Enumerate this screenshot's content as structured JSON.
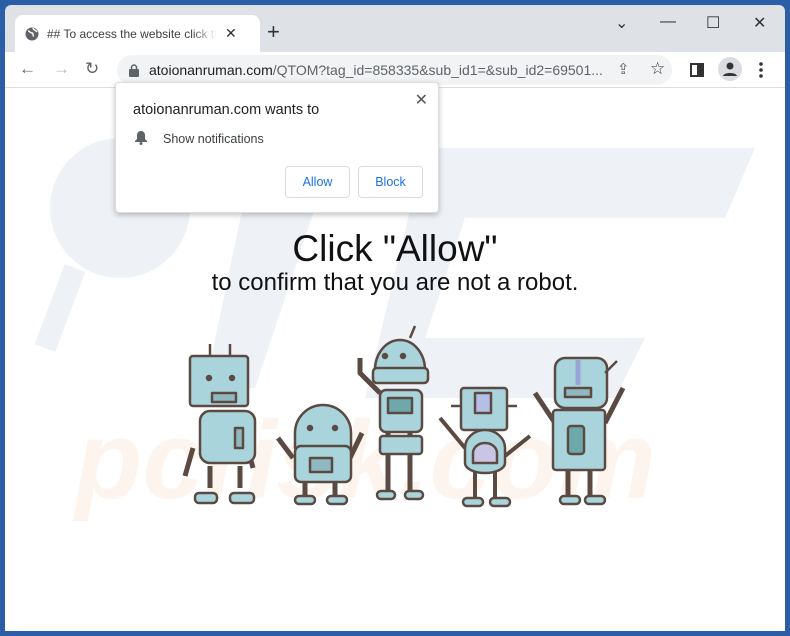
{
  "tab": {
    "title": "## To access the website click the",
    "close": "✕",
    "favicon": "globe-icon"
  },
  "new_tab": "+",
  "window_controls": {
    "dropdown": "⌄",
    "minimize": "—",
    "maximize": "☐",
    "close": "✕"
  },
  "toolbar": {
    "back": "←",
    "forward": "→",
    "reload": "↻",
    "url_host": "atoionanruman.com",
    "url_path": "/QTOM?tag_id=858335&sub_id1=&sub_id2=69501...",
    "share": "⇪",
    "bookmark": "☆"
  },
  "popup": {
    "heading": "atoionanruman.com wants to",
    "permission": "Show notifications",
    "allow": "Allow",
    "block": "Block",
    "close": "✕"
  },
  "page": {
    "headline": "Click \"Allow\"",
    "subline": "to confirm that you are not a robot."
  },
  "watermark": "pcrisk.com",
  "colors": {
    "accent": "#1a73e8",
    "robot": "#a9d4dc",
    "outline": "#5a4a42"
  }
}
